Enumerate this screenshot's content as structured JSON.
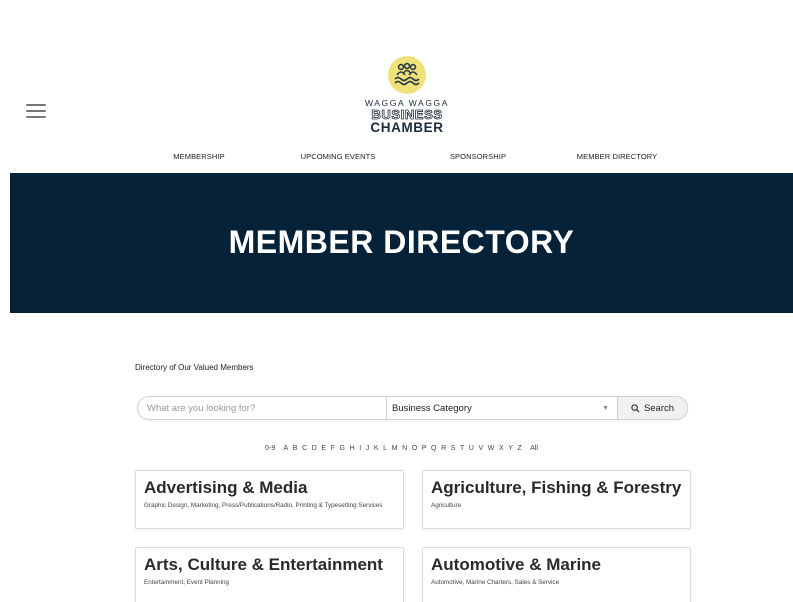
{
  "logo": {
    "line1": "WAGGA WAGGA",
    "line2": "BUSINESS",
    "line3": "CHAMBER",
    "badge_color": "#f0e27a"
  },
  "nav": [
    {
      "label": "MEMBERSHIP"
    },
    {
      "label": "UPCOMING EVENTS"
    },
    {
      "label": "SPONSORSHIP"
    },
    {
      "label": "MEMBER DIRECTORY"
    }
  ],
  "hero": {
    "title": "MEMBER DIRECTORY",
    "background": "#062238"
  },
  "directory": {
    "label": "Directory of Our Valued Members",
    "search_placeholder": "What are you looking for?",
    "category_value": "Business Category",
    "search_button": "Search"
  },
  "alphabet": [
    "0-9",
    "A",
    "B",
    "C",
    "D",
    "E",
    "F",
    "G",
    "H",
    "I",
    "J",
    "K",
    "L",
    "M",
    "N",
    "O",
    "P",
    "Q",
    "R",
    "S",
    "T",
    "U",
    "V",
    "W",
    "X",
    "Y",
    "Z",
    "All"
  ],
  "categories": [
    {
      "title": "Advertising & Media",
      "subtitle": "Graphic Design, Marketing, Press/Publications/Radio, Printing & Typesetting Services"
    },
    {
      "title": "Agriculture, Fishing & Forestry",
      "subtitle": "Agriculture"
    },
    {
      "title": "Arts, Culture & Entertainment",
      "subtitle": "Entertainment, Event Planning"
    },
    {
      "title": "Automotive & Marine",
      "subtitle": "Automotive, Marine Charters, Sales & Service"
    }
  ]
}
